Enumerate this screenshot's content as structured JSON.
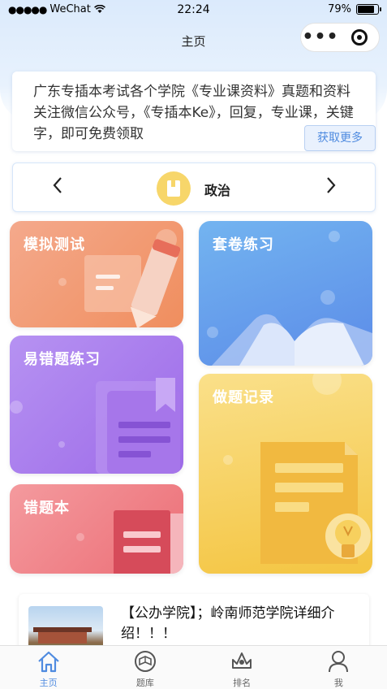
{
  "status_bar": {
    "carrier": "WeChat",
    "time": "22:24",
    "battery": "79%",
    "battery_level": 0.79
  },
  "nav": {
    "title": "主页"
  },
  "notice": {
    "text": "广东专插本考试各个学院《专业课资料》真题和资料关注微信公众号，《专插本Ke》，回复，专业课，关键字，即可免费领取",
    "more_label": "获取更多"
  },
  "subject": {
    "name": "政治",
    "prev": "<",
    "next": ">"
  },
  "cards": {
    "mock_test": "模拟测试",
    "paper_practice": "套卷练习",
    "error_prone": "易错题练习",
    "records": "做题记录",
    "mistakes_book": "错题本"
  },
  "article": {
    "title": "【公办学院】；岭南师范学院详细介绍！！！"
  },
  "tabbar": {
    "items": [
      {
        "label": "主页",
        "icon": "home-icon",
        "active": true
      },
      {
        "label": "题库",
        "icon": "question-bank-icon",
        "active": false
      },
      {
        "label": "排名",
        "icon": "ranking-icon",
        "active": false
      },
      {
        "label": "我",
        "icon": "profile-icon",
        "active": false
      }
    ]
  },
  "colors": {
    "accent": "#4f8be0",
    "card_orange": "#f08e5e",
    "card_blue": "#5b8be8",
    "card_purple": "#9d6ae8",
    "card_yellow": "#f4c542",
    "card_red": "#ec6e76"
  }
}
